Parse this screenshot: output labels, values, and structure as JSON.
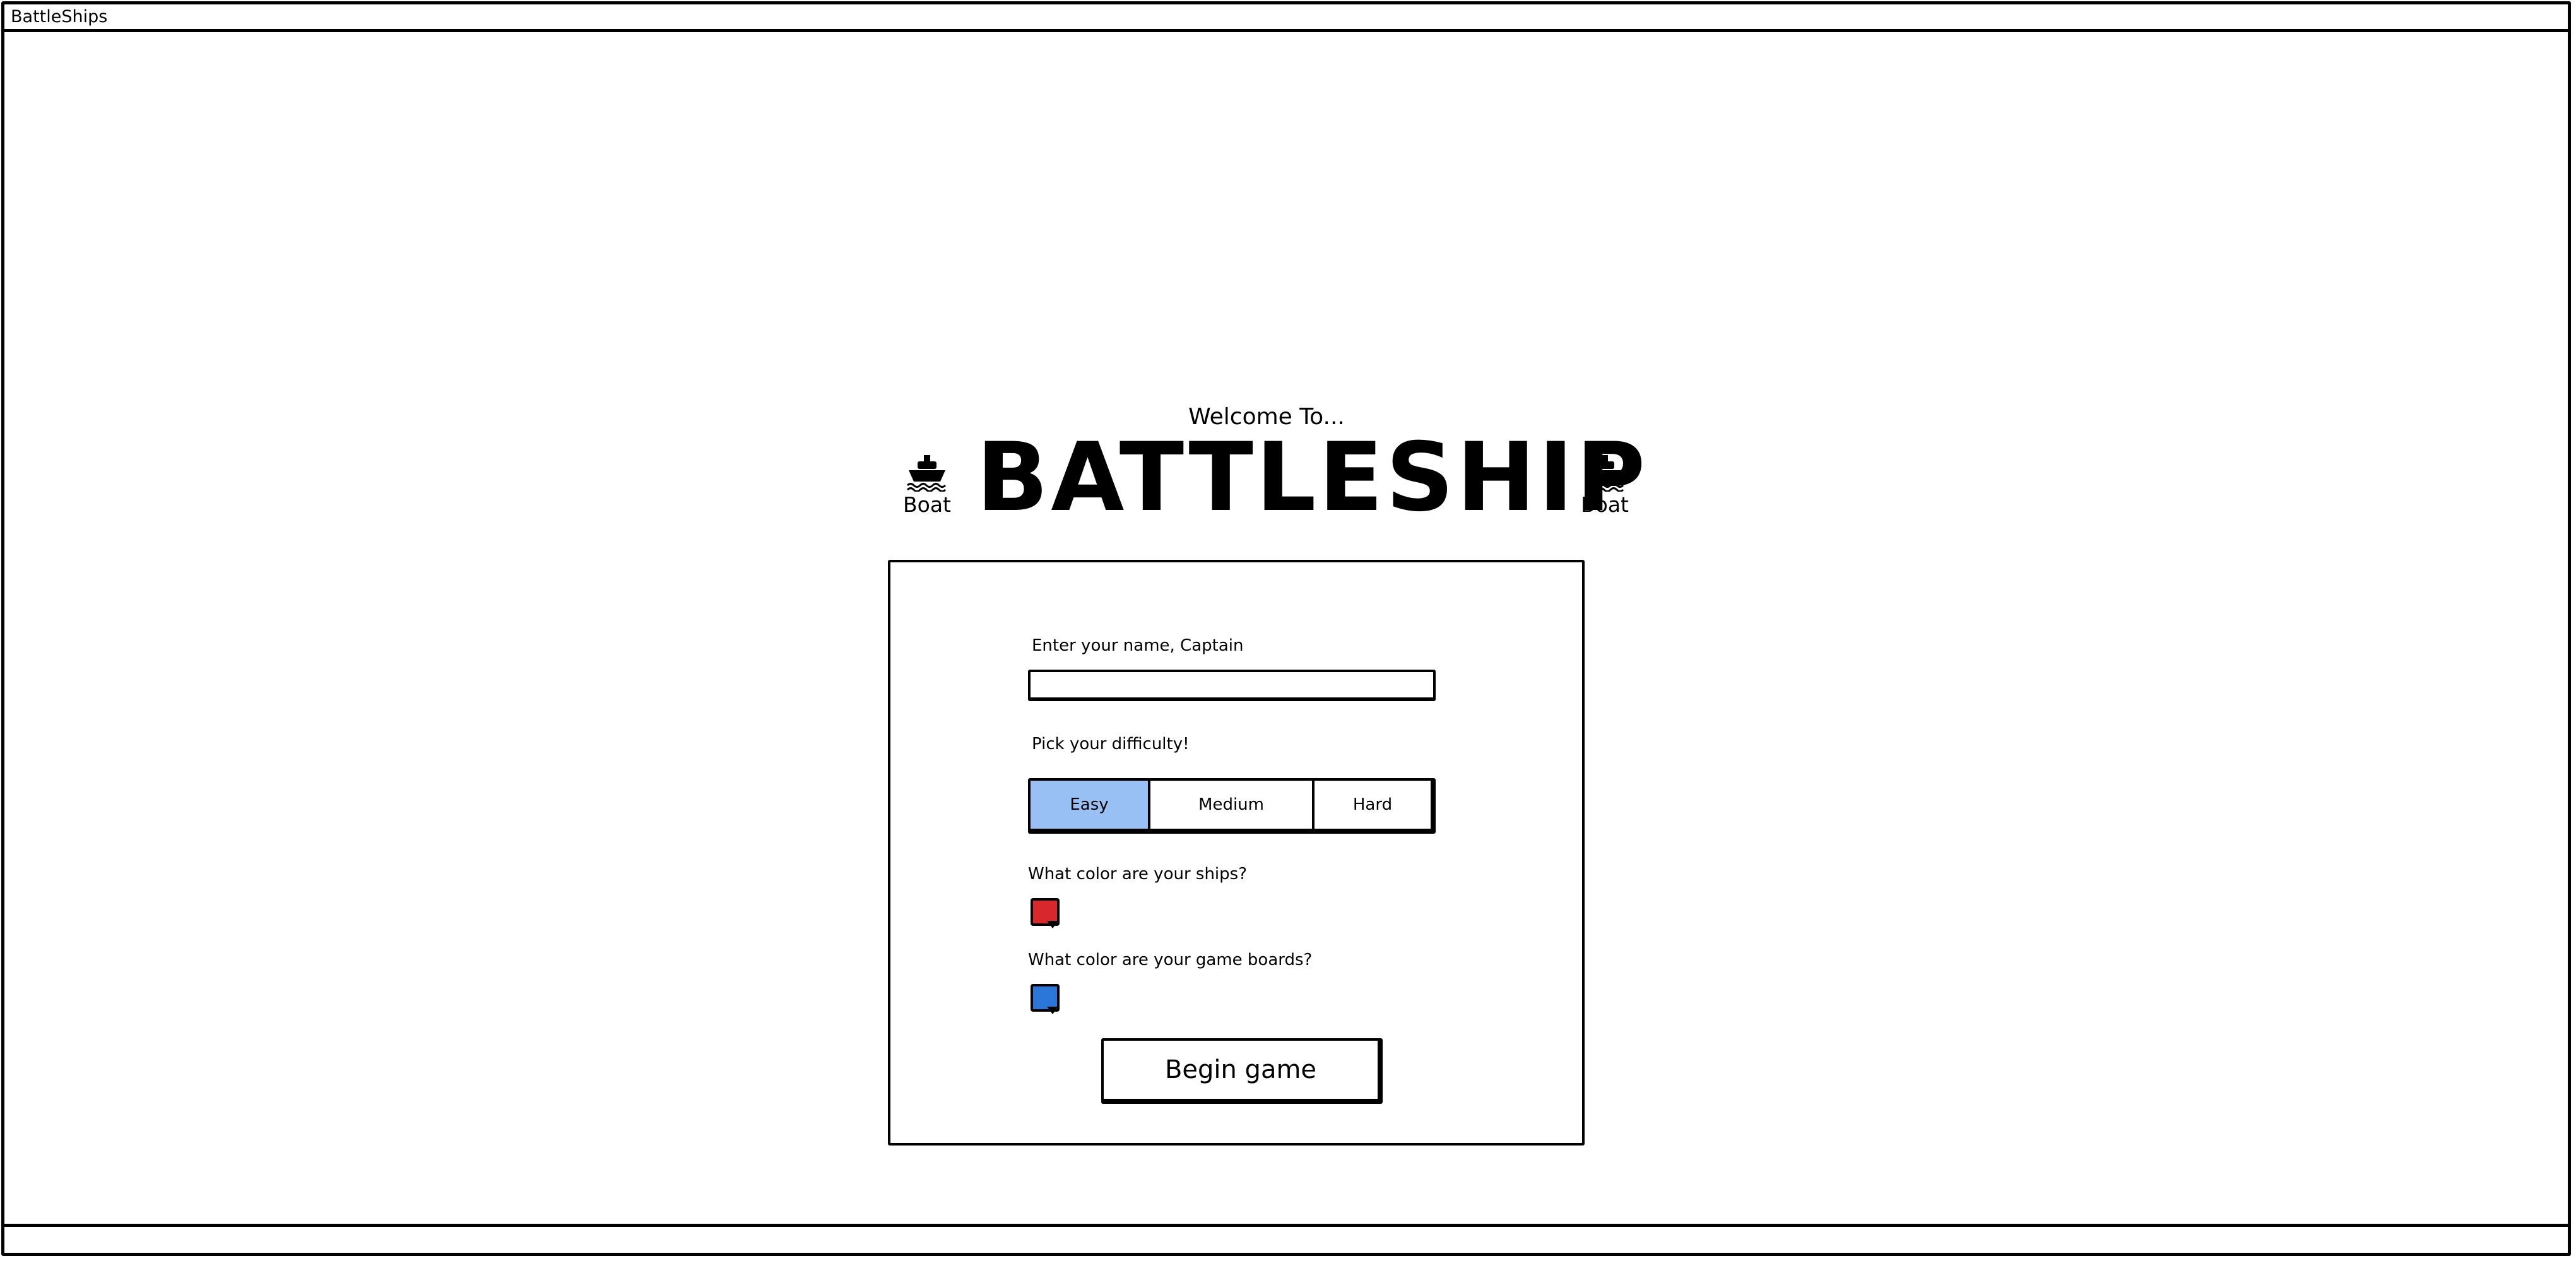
{
  "window": {
    "title": "BattleShips"
  },
  "header": {
    "welcome": "Welcome To...",
    "title": "BATTLESHIP",
    "left_icon_label": "Boat",
    "right_icon_label": "Boat",
    "icon": "ship-icon"
  },
  "form": {
    "name_label": "Enter your name, Captain",
    "name_value": "",
    "difficulty_label": "Pick your difficulty!",
    "difficulty_options": [
      "Easy",
      "Medium",
      "Hard"
    ],
    "difficulty_selected": "Easy",
    "ship_color_label": "What color are your ships?",
    "ship_color": "#d8282c",
    "board_color_label": "What color are your game boards?",
    "board_color": "#2b77d9",
    "begin_label": "Begin game"
  },
  "colors": {
    "selected_segment": "#99c0f5"
  }
}
